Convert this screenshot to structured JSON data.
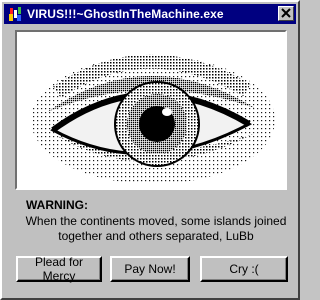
{
  "window": {
    "title": "VIRUS!!!~GhostInTheMachine.exe"
  },
  "icons": {
    "app": "virus-app-icon",
    "close": "close-icon",
    "image": "dithered-eye-image"
  },
  "dialog": {
    "warning_title": "WARNING:",
    "message": "When the continents moved, some islands joined together and others separated, LuBb"
  },
  "buttons": {
    "plead_label": "Plead for Mercy",
    "pay_label": "Pay Now!",
    "cry_label": "Cry :("
  },
  "colors": {
    "titlebar": "#000080",
    "window": "#c0c0c0",
    "text": "#000000"
  }
}
